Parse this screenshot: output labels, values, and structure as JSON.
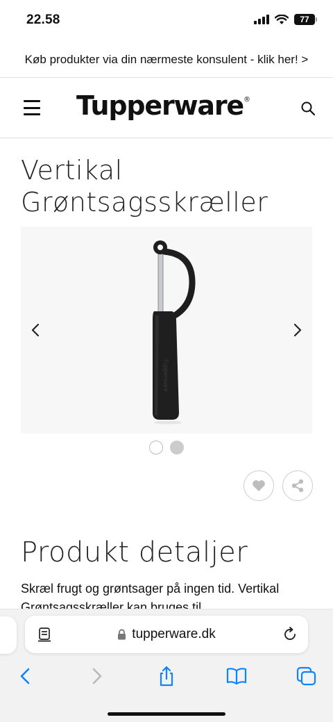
{
  "status_bar": {
    "time": "22.58",
    "battery": "77"
  },
  "promo": {
    "text": "Køb produkter via din nærmeste konsulent - klik her! >"
  },
  "header": {
    "logo": "Tupperware",
    "logo_mark": "®"
  },
  "product": {
    "title": "Vertikal Grøntsagsskræller",
    "carousel_total": 2,
    "carousel_active": 2,
    "product_imprint": "Tupperware"
  },
  "details": {
    "heading": "Produkt detaljer",
    "text": "Skræl frugt og grøntsager på ingen tid. Vertikal Grøntsagsskræller kan bruges til"
  },
  "browser": {
    "url": "tupperware.dk",
    "accent": "#0a84ff",
    "nav_icons": [
      "back-icon",
      "forward-icon",
      "share-icon",
      "bookmarks-icon",
      "tabs-icon"
    ]
  }
}
